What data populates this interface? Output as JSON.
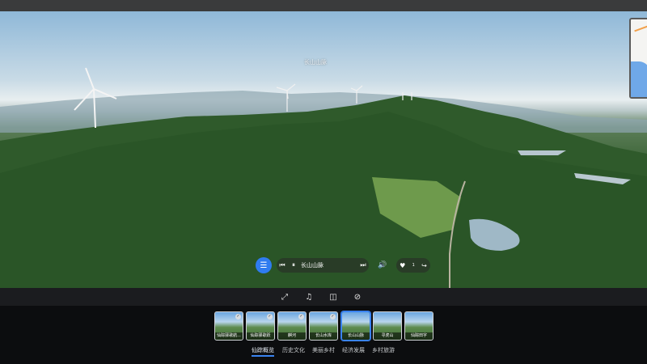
{
  "scene": {
    "title": "长山山脉"
  },
  "player": {
    "menu_icon": "menu-icon",
    "track_name": "长山山脉",
    "like_count": "1"
  },
  "toolbar": {
    "icons": [
      "expand-icon",
      "music-icon",
      "vr-icon",
      "gyroscope-icon"
    ]
  },
  "thumbnails": [
    {
      "label": "仙踪驿歌航...",
      "checked": true,
      "active": false
    },
    {
      "label": "仙踪驿歌跃",
      "checked": true,
      "active": false
    },
    {
      "label": "麒河",
      "checked": true,
      "active": false
    },
    {
      "label": "长山水库",
      "checked": true,
      "active": false
    },
    {
      "label": "长山山脉",
      "checked": false,
      "active": true
    },
    {
      "label": "寻虎山",
      "checked": false,
      "active": false
    },
    {
      "label": "仙踪田字",
      "checked": false,
      "active": false
    }
  ],
  "tabs": [
    {
      "label": "仙踪概览",
      "active": true
    },
    {
      "label": "历史文化",
      "active": false
    },
    {
      "label": "美丽乡村",
      "active": false
    },
    {
      "label": "经济发展",
      "active": false
    },
    {
      "label": "乡村旅游",
      "active": false
    }
  ],
  "colors": {
    "accent": "#2f7cf0"
  }
}
